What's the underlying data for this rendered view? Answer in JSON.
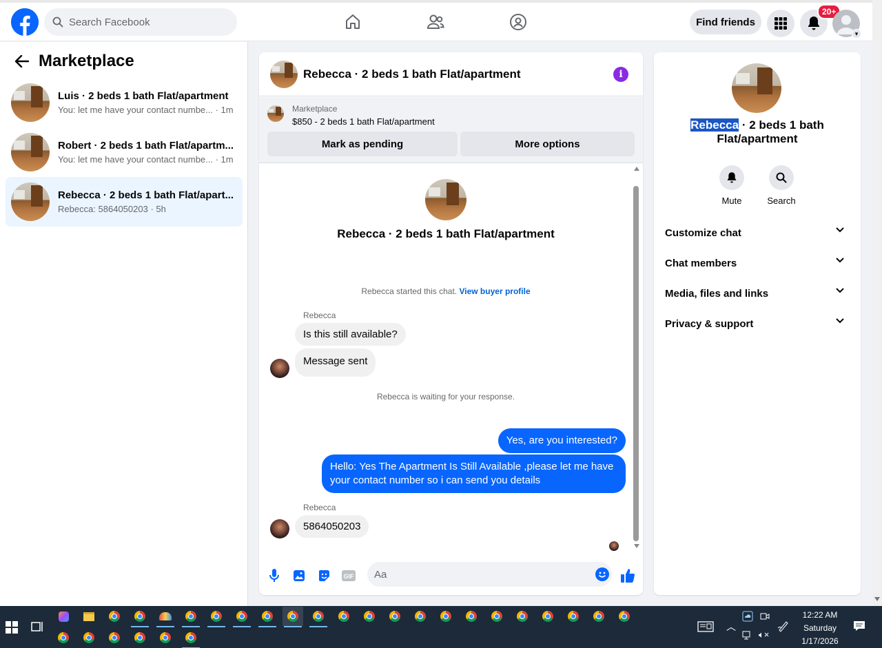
{
  "topbar": {
    "search_placeholder": "Search Facebook",
    "find_friends": "Find friends",
    "notif_count": "20+"
  },
  "sidebar": {
    "title": "Marketplace",
    "conversations": [
      {
        "name": "Luis · 2 beds 1 bath Flat/apartment",
        "snippet": "You: let me have your contact numbe... · 1m"
      },
      {
        "name": "Robert · 2 beds 1 bath Flat/apartm...",
        "snippet": "You: let me have your contact numbe... · 1m"
      },
      {
        "name": "Rebecca · 2 beds 1 bath Flat/apart...",
        "snippet": "Rebecca: 5864050203 · 5h"
      }
    ]
  },
  "chat": {
    "header_title": "Rebecca · 2 beds 1 bath Flat/apartment",
    "listing_label": "Marketplace",
    "listing_price": "$850 - 2 beds 1 bath Flat/apartment",
    "mark_pending": "Mark as pending",
    "more_options": "More options",
    "intro_title": "Rebecca · 2 beds 1 bath Flat/apartment",
    "started_text": "Rebecca started this chat.",
    "view_buyer_profile": "View buyer profile",
    "sender1": "Rebecca",
    "msg1": "Is this still available?",
    "msg2": "Message sent",
    "waiting_text": "Rebecca is waiting for your response.",
    "out1": "Yes, are you interested?",
    "out2": "Hello: Yes The Apartment Is Still Available ,please let me have your contact number so i can send you details",
    "sender2": "Rebecca",
    "msg3": "5864050203",
    "composer_placeholder": "Aa"
  },
  "info": {
    "name_highlight": "Rebecca",
    "title_rest": " · 2 beds 1 bath Flat/apartment",
    "mute": "Mute",
    "search": "Search",
    "accordions": [
      "Customize chat",
      "Chat members",
      "Media, files and links",
      "Privacy & support"
    ]
  },
  "taskbar": {
    "time": "12:22 AM",
    "day": "Saturday",
    "date": "1/17/2026"
  },
  "colors": {
    "brand": "#0866ff",
    "active_conversation": "#ebf5ff",
    "notif_badge": "#e41e3f",
    "taskbar": "#1c2a3a"
  }
}
